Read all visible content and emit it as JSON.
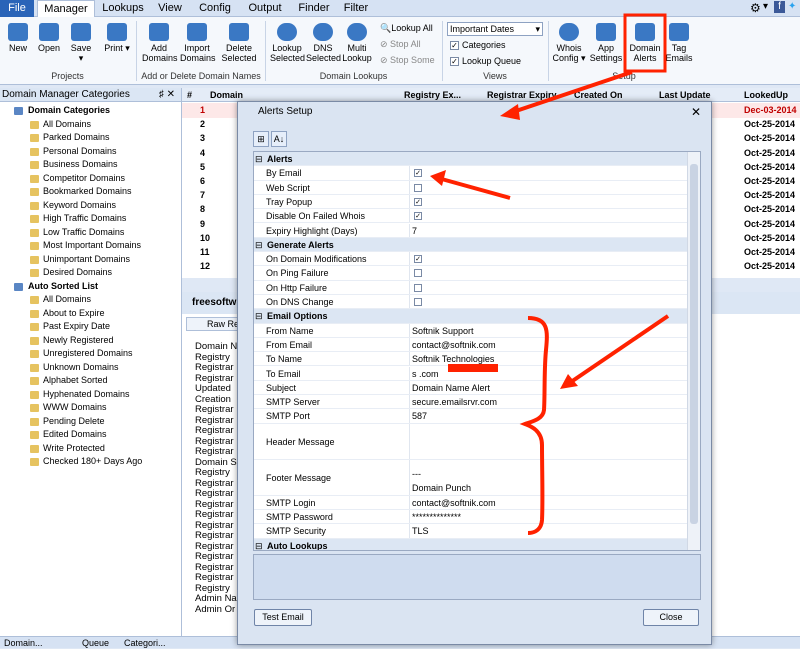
{
  "menubar": {
    "file": "File",
    "tabs": [
      "Manager",
      "Lookups",
      "View",
      "Config",
      "Output",
      "Finder",
      "Filter"
    ],
    "active": "Manager"
  },
  "ribbon": {
    "buttons": [
      "New",
      "Open",
      "Save",
      "Print",
      "Add Domains",
      "Import Domains",
      "Delete Selected",
      "Lookup Selected",
      "DNS Selected",
      "Multi Lookup",
      "Whois Config",
      "App Settings",
      "Domain Alerts",
      "Tag Emails"
    ],
    "lookup_all": "Lookup All",
    "stop_all": "Stop All",
    "stop_some": "Stop Some",
    "view_select": "Important Dates",
    "categories": "Categories",
    "lookup_queue": "Lookup Queue",
    "groups": {
      "projects": "Projects",
      "add_delete": "Add or Delete Domain Names",
      "domain_lookups": "Domain Lookups",
      "views": "Views",
      "setup": "Setup"
    }
  },
  "left_panel": {
    "title": "Domain Manager Categories",
    "pin": "♯ ✕",
    "categories_root": "Domain Categories",
    "categories": [
      "All Domains",
      "Parked Domains",
      "Personal Domains",
      "Business Domains",
      "Competitor Domains",
      "Bookmarked Domains",
      "Keyword Domains",
      "High Traffic Domains",
      "Low Traffic Domains",
      "Most Important Domains",
      "Unimportant Domains",
      "Desired Domains"
    ],
    "auto_root": "Auto Sorted List",
    "auto": [
      "All Domains",
      "About to Expire",
      "Past Expiry Date",
      "Newly Registered",
      "Unregistered Domains",
      "Unknown Domains",
      "Alphabet Sorted",
      "Hyphenated Domains",
      "WWW Domains",
      "Pending Delete",
      "Edited Domains",
      "Write Protected",
      "Checked 180+ Days Ago"
    ]
  },
  "grid": {
    "columns": [
      "#",
      "Domain",
      "Registry Ex...",
      "Registrar Expiry",
      "Created On",
      "Last Update",
      "LookedUp"
    ],
    "rows": [
      {
        "n": "1",
        "d": "Dec-03-2014"
      },
      {
        "n": "2",
        "d": "Oct-25-2014"
      },
      {
        "n": "3",
        "d": "Oct-25-2014"
      },
      {
        "n": "4",
        "d": "Oct-25-2014"
      },
      {
        "n": "5",
        "d": "Oct-25-2014"
      },
      {
        "n": "6",
        "d": "Oct-25-2014"
      },
      {
        "n": "7",
        "d": "Oct-25-2014"
      },
      {
        "n": "8",
        "d": "Oct-25-2014"
      },
      {
        "n": "9",
        "d": "Oct-25-2014"
      },
      {
        "n": "10",
        "d": "Oct-25-2014"
      },
      {
        "n": "11",
        "d": "Oct-25-2014"
      },
      {
        "n": "12",
        "d": "Oct-25-2014"
      }
    ]
  },
  "domain_header": "freesoftw",
  "raw_tab": "Raw Re",
  "raw_lines": [
    "Domain N",
    "Registry",
    "Registrar",
    "Registrar",
    "Updated",
    "Creation",
    "Registrar",
    "Registrar",
    "Registrar",
    "Registrar",
    "Registrar",
    "Domain S",
    "Registry",
    "Registrar",
    "Registrar",
    "Registrar",
    "Registrar",
    "Registrar",
    "Registrar",
    "Registrar",
    "Registrar",
    "Registrar",
    "Registrar",
    "Registry",
    "Admin Na",
    "Admin Or"
  ],
  "bottom_tabs": [
    "Domain...",
    "Queue",
    "Categori..."
  ],
  "dialog": {
    "title": "Alerts Setup",
    "close": "✕",
    "sections": [
      {
        "type": "cat",
        "label": "Alerts"
      },
      {
        "label": "By Email",
        "check": true
      },
      {
        "label": "Web Script",
        "check": false
      },
      {
        "label": "Tray Popup",
        "check": true
      },
      {
        "label": "Disable On Failed Whois",
        "check": true
      },
      {
        "label": "Expiry Highlight (Days)",
        "value": "7"
      },
      {
        "type": "cat",
        "label": "Generate Alerts"
      },
      {
        "label": "On Domain Modifications",
        "check": true
      },
      {
        "label": "On Ping Failure",
        "check": false
      },
      {
        "label": "On Http Failure",
        "check": false
      },
      {
        "label": "On DNS Change",
        "check": false
      },
      {
        "type": "cat",
        "label": "Email Options"
      },
      {
        "label": "From Name",
        "value": "Softnik Support"
      },
      {
        "label": "From Email",
        "value": "contact@softnik.com"
      },
      {
        "label": "To Name",
        "value": "Softnik Technologies"
      },
      {
        "label": "To Email",
        "value": "s          .com"
      },
      {
        "label": "Subject",
        "value": "Domain Name Alert"
      },
      {
        "label": "SMTP Server",
        "value": "secure.emailsrvr.com"
      },
      {
        "label": "SMTP Port",
        "value": "587"
      },
      {
        "label": "Header Message",
        "value": "",
        "tall": true
      },
      {
        "label": "Footer Message",
        "value": "---",
        "value2": "Domain Punch",
        "tall": true
      },
      {
        "label": "SMTP Login",
        "value": "contact@softnik.com"
      },
      {
        "label": "SMTP Password",
        "value": "**************"
      },
      {
        "label": "SMTP Security",
        "value": "TLS"
      },
      {
        "type": "cat",
        "label": "Auto Lookups"
      }
    ],
    "test_email": "Test Email",
    "close_button": "Close"
  },
  "colors": {
    "accent": "#2a64b8",
    "annotation": "#ff2200",
    "overdue": "#c00000"
  }
}
